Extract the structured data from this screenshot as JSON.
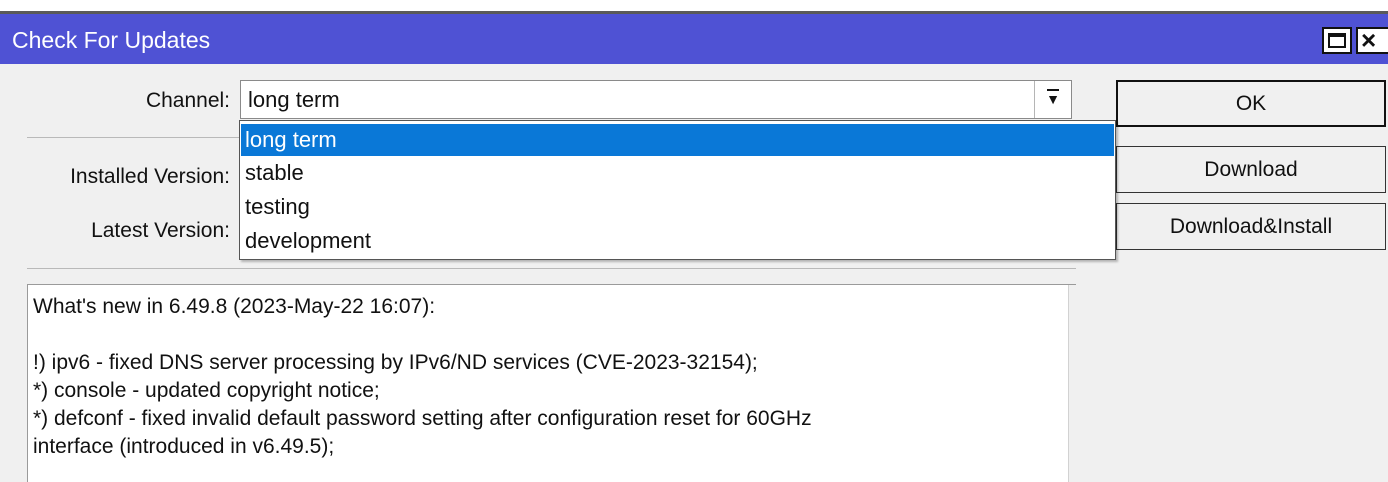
{
  "window": {
    "title": "Check For Updates",
    "close_glyph": "×",
    "maximize_icon": "maximize-icon"
  },
  "form": {
    "channel_label": "Channel:",
    "channel_value": "long term",
    "installed_label": "Installed Version:",
    "latest_label": "Latest Version:",
    "dropdown_icon": "dropdown-arrow-icon"
  },
  "dropdown": {
    "options": [
      "long term",
      "stable",
      "testing",
      "development"
    ],
    "selected_index": 0,
    "highlight_color": "#0a78d7"
  },
  "buttons": {
    "ok": "OK",
    "download": "Download",
    "download_install": "Download&Install"
  },
  "changelog": {
    "lines": [
      "What's new in 6.49.8 (2023-May-22 16:07):",
      "",
      "!) ipv6 - fixed DNS server processing by IPv6/ND services (CVE-2023-32154);",
      "*) console - updated copyright notice;",
      "*) defconf - fixed invalid default password setting after configuration reset for 60GHz",
      "interface (introduced in v6.49.5);"
    ]
  },
  "colors": {
    "titlebar": "#4f52d4",
    "window_bg": "#f0f0f0"
  }
}
